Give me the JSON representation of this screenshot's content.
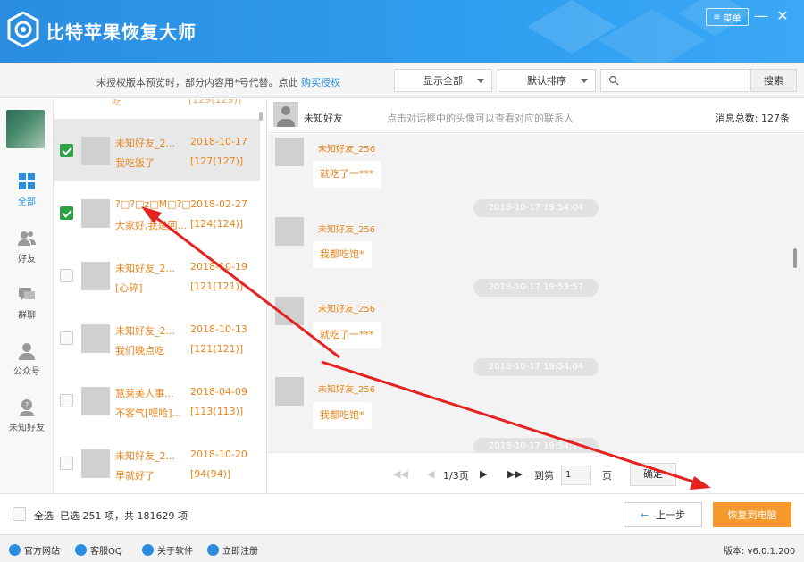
{
  "app": {
    "title": "比特苹果恢复大师",
    "menu_label": "菜单",
    "minimize": "—",
    "close": "✕"
  },
  "toolbar": {
    "notice": "未授权版本预览时，部分内容用*号代替。点此",
    "buy_link": "购买授权",
    "filter_dropdown": "显示全部",
    "sort_dropdown": "默认排序",
    "search_placeholder": "",
    "search_button": "搜索"
  },
  "sidebar": {
    "items": [
      {
        "label": "全部",
        "icon": "grid-icon",
        "active": true
      },
      {
        "label": "好友",
        "icon": "friends-icon"
      },
      {
        "label": "群聊",
        "icon": "group-chat-icon"
      },
      {
        "label": "公众号",
        "icon": "official-account-icon"
      },
      {
        "label": "未知好友",
        "icon": "unknown-friend-icon"
      }
    ]
  },
  "conversations": [
    {
      "name": "未知好友_2...",
      "date": "2018-10-17",
      "message": "我吃饭了",
      "count": "[127(127)]",
      "checked": true,
      "selected": true
    },
    {
      "name": "?□?□z□M□?□...",
      "date": "2018-02-27",
      "message": "大家好,我是回...",
      "count": "[124(124)]",
      "checked": true,
      "selected": false
    },
    {
      "name": "未知好友_2...",
      "date": "2018-10-19",
      "message": "[心碎]",
      "count": "[121(121)]",
      "checked": false,
      "selected": false
    },
    {
      "name": "未知好友_2...",
      "date": "2018-10-13",
      "message": "我们晚点吃",
      "count": "[121(121)]",
      "checked": false,
      "selected": false
    },
    {
      "name": "慧莱美人事...",
      "date": "2018-04-09",
      "message": "不客气[嘿哈]...",
      "count": "[113(113)]",
      "checked": false,
      "selected": false
    },
    {
      "name": "未知好友_2...",
      "date": "2018-10-20",
      "message": "早就好了",
      "count": "[94(94)]",
      "checked": false,
      "selected": false
    }
  ],
  "chat": {
    "contact_name": "未知好友",
    "hint": "点击对话框中的头像可以查看对应的联系人",
    "total": "消息总数: 127条",
    "messages": [
      {
        "sender": "未知好友_256",
        "text": "就吃了一***"
      },
      {
        "timestamp": "2018-10-17 19:54:04"
      },
      {
        "sender": "未知好友_256",
        "text": "我都吃饱*"
      },
      {
        "timestamp": "2018-10-17 19:53:57"
      },
      {
        "sender": "未知好友_256",
        "text": "就吃了一***"
      },
      {
        "timestamp": "2018-10-17 19:54:04"
      },
      {
        "sender": "未知好友_256",
        "text": "我都吃饱*"
      },
      {
        "timestamp": "2018-10-17 19:54:16"
      }
    ]
  },
  "pager": {
    "page_info": "1/3页",
    "goto_label": "到第",
    "page_value": "1",
    "page_unit": "页",
    "ok_button": "确定"
  },
  "bottom": {
    "select_all": "全选",
    "selected_info": "已选 251 项，共 181629 项",
    "prev_button": "上一步",
    "recover_button": "恢复到电脑"
  },
  "footer": {
    "links": [
      {
        "label": "官方网站",
        "icon": "home-icon"
      },
      {
        "label": "客服QQ",
        "icon": "qq-icon"
      },
      {
        "label": "关于软件",
        "icon": "info-icon"
      },
      {
        "label": "立即注册",
        "icon": "register-icon"
      }
    ],
    "version": "版本: v6.0.1.200"
  },
  "colors": {
    "brand": "#2a8de0",
    "accent_orange": "#e8851c",
    "recover_btn": "#f79a2e",
    "check_green": "#2ca043",
    "arrow_red": "#e52222"
  }
}
